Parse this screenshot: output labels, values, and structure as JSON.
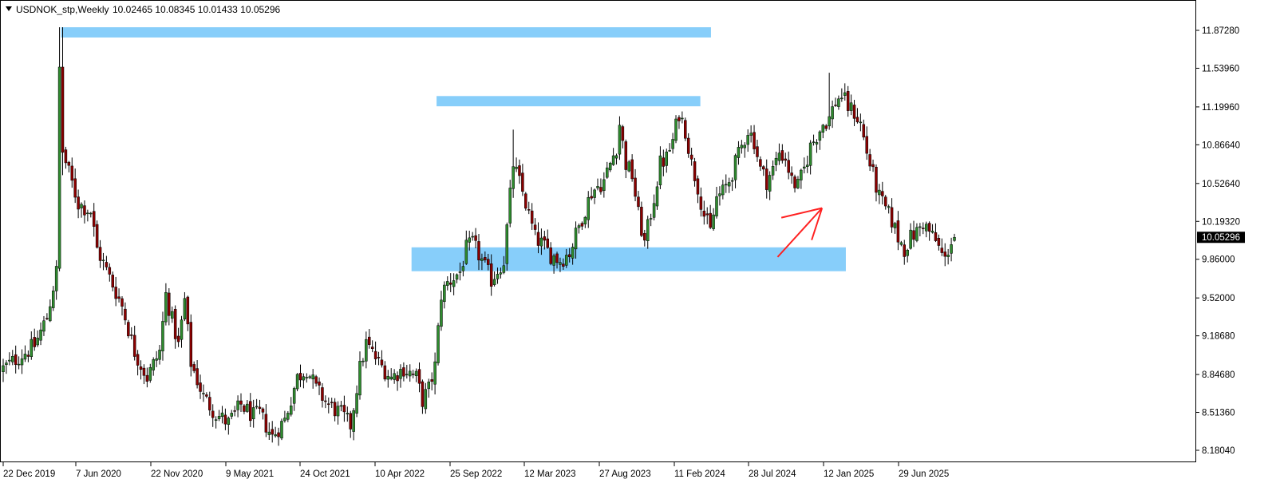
{
  "header": {
    "symbol_timeframe": "USDNOK_stp,Weekly",
    "ohlc": "10.02465 10.08345 10.01433 10.05296"
  },
  "colors": {
    "bull_body": "#2e8b2e",
    "bear_body": "#8b0000",
    "wick": "#000000",
    "zone": "#87cefa",
    "arrow": "#ff2020",
    "current_price_bg": "#000000",
    "current_price_text": "#ffffff",
    "frame": "#000000"
  },
  "chart_data": {
    "type": "candlestick",
    "symbol": "USDNOK_stp",
    "timeframe": "Weekly",
    "last_ohlc": {
      "open": 10.02465,
      "high": 10.08345,
      "low": 10.01433,
      "close": 10.05296
    },
    "current_price_label": "10.05296",
    "y_range": [
      8.0925,
      12.0875
    ],
    "y_ticks": [
      "11.87280",
      "11.53960",
      "11.19960",
      "10.86640",
      "10.52640",
      "10.19320",
      "9.86000",
      "9.52000",
      "9.18680",
      "8.84680",
      "8.51360",
      "8.18040"
    ],
    "x_ticks": [
      "22 Dec 2019",
      "7 Jun 2020",
      "22 Nov 2020",
      "9 May 2021",
      "24 Oct 2021",
      "10 Apr 2022",
      "25 Sep 2022",
      "12 Mar 2023",
      "27 Aug 2023",
      "11 Feb 2024",
      "28 Jul 2024",
      "12 Jan 2025",
      "29 Jun 2025"
    ],
    "x_domain": [
      0,
      304
    ],
    "close_path": [
      [
        0,
        8.9
      ],
      [
        6,
        9.02
      ],
      [
        10,
        9.1
      ],
      [
        14,
        9.35
      ],
      [
        17,
        9.75
      ],
      [
        18,
        11.7
      ],
      [
        19,
        10.8
      ],
      [
        24,
        10.35
      ],
      [
        28,
        10.28
      ],
      [
        30,
        9.95
      ],
      [
        34,
        9.7
      ],
      [
        38,
        9.45
      ],
      [
        42,
        9.05
      ],
      [
        46,
        8.82
      ],
      [
        50,
        9.05
      ],
      [
        52,
        9.55
      ],
      [
        56,
        9.1
      ],
      [
        58,
        9.5
      ],
      [
        60,
        8.95
      ],
      [
        64,
        8.65
      ],
      [
        68,
        8.5
      ],
      [
        72,
        8.42
      ],
      [
        76,
        8.58
      ],
      [
        80,
        8.48
      ],
      [
        82,
        8.5
      ],
      [
        86,
        8.3
      ],
      [
        90,
        8.45
      ],
      [
        94,
        8.82
      ],
      [
        97,
        8.9
      ],
      [
        100,
        8.72
      ],
      [
        104,
        8.58
      ],
      [
        108,
        8.5
      ],
      [
        111,
        8.4
      ],
      [
        114,
        8.9
      ],
      [
        116,
        9.12
      ],
      [
        120,
        8.95
      ],
      [
        124,
        8.82
      ],
      [
        128,
        8.9
      ],
      [
        132,
        8.82
      ],
      [
        134,
        8.62
      ],
      [
        136,
        8.72
      ],
      [
        138,
        8.92
      ],
      [
        140,
        9.55
      ],
      [
        142,
        9.65
      ],
      [
        146,
        9.75
      ],
      [
        148,
        9.95
      ],
      [
        150,
        10.0
      ],
      [
        152,
        9.9
      ],
      [
        156,
        9.68
      ],
      [
        160,
        9.85
      ],
      [
        163,
        10.7
      ],
      [
        166,
        10.45
      ],
      [
        170,
        10.05
      ],
      [
        172,
        10.0
      ],
      [
        175,
        9.9
      ],
      [
        178,
        9.85
      ],
      [
        181,
        9.92
      ],
      [
        184,
        10.15
      ],
      [
        188,
        10.45
      ],
      [
        192,
        10.55
      ],
      [
        196,
        10.85
      ],
      [
        197,
        11.05
      ],
      [
        199,
        10.7
      ],
      [
        201,
        10.6
      ],
      [
        203,
        10.25
      ],
      [
        205,
        10.0
      ],
      [
        208,
        10.4
      ],
      [
        210,
        10.7
      ],
      [
        212,
        10.75
      ],
      [
        214,
        10.9
      ],
      [
        216,
        11.15
      ],
      [
        218,
        11.0
      ],
      [
        220,
        10.7
      ],
      [
        222,
        10.5
      ],
      [
        224,
        10.25
      ],
      [
        226,
        10.1
      ],
      [
        228,
        10.4
      ],
      [
        230,
        10.45
      ],
      [
        232,
        10.55
      ],
      [
        234,
        10.7
      ],
      [
        236,
        10.85
      ],
      [
        238,
        11.0
      ],
      [
        240,
        10.9
      ],
      [
        242,
        10.65
      ],
      [
        244,
        10.55
      ],
      [
        246,
        10.65
      ],
      [
        248,
        10.8
      ],
      [
        250,
        10.75
      ],
      [
        252,
        10.55
      ],
      [
        254,
        10.5
      ],
      [
        256,
        10.65
      ],
      [
        258,
        10.85
      ],
      [
        260,
        10.95
      ],
      [
        262,
        11.05
      ],
      [
        264,
        11.1
      ],
      [
        266,
        11.25
      ],
      [
        268,
        11.3
      ],
      [
        270,
        11.2
      ],
      [
        272,
        11.15
      ],
      [
        274,
        11.05
      ],
      [
        276,
        10.8
      ],
      [
        278,
        10.6
      ],
      [
        280,
        10.4
      ],
      [
        282,
        10.3
      ],
      [
        284,
        10.2
      ],
      [
        286,
        10.05
      ],
      [
        288,
        9.95
      ],
      [
        290,
        10.05
      ],
      [
        292,
        10.1
      ],
      [
        294,
        10.18
      ],
      [
        296,
        10.1
      ],
      [
        298,
        10.02
      ],
      [
        300,
        9.9
      ],
      [
        301,
        9.85
      ],
      [
        302,
        9.95
      ],
      [
        303,
        10.02
      ],
      [
        304,
        10.05
      ]
    ],
    "spikes": [
      {
        "i": 18,
        "high": 11.9,
        "low": 10.55
      },
      {
        "i": 19,
        "high": 11.9,
        "low": 10.6
      },
      {
        "i": 163,
        "high": 11.0,
        "low": 10.4
      },
      {
        "i": 264,
        "high": 11.5,
        "low": 11.15
      }
    ],
    "zones": [
      {
        "x0": 18.5,
        "x1": 226.2,
        "y0": 11.81,
        "y1": 11.9
      },
      {
        "x0": 138.5,
        "x1": 222.8,
        "y0": 11.205,
        "y1": 11.295
      },
      {
        "x0": 130.5,
        "x1": 269.3,
        "y0": 9.755,
        "y1": 9.965
      }
    ],
    "arrow": {
      "from": [
        247.5,
        9.88
      ],
      "to": [
        261.7,
        10.31
      ]
    }
  }
}
